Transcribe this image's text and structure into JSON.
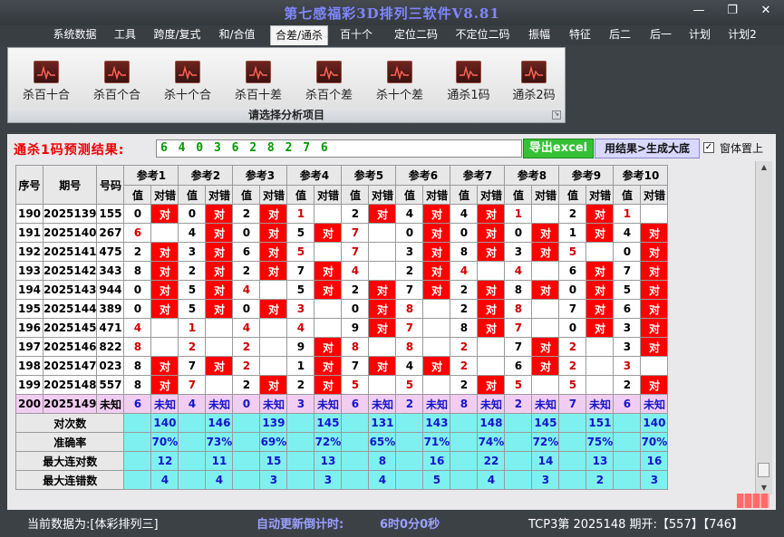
{
  "window": {
    "title": "第七感福彩3D排列三软件V8.81"
  },
  "menu": [
    "系统数据",
    "工具",
    "跨度/复式",
    "和/合值",
    "合差/通杀",
    "百十个",
    "定位二码",
    "不定位二码",
    "振幅",
    "特征",
    "后二",
    "后一",
    "计划",
    "计划2"
  ],
  "menu_active": "合差/通杀",
  "ribbon": {
    "buttons": [
      "杀百十合",
      "杀百个合",
      "杀十个合",
      "杀百十差",
      "杀百个差",
      "杀十个差",
      "通杀1码",
      "通杀2码"
    ],
    "footer": "请选择分析项目",
    "icon": "chart-icon"
  },
  "prediction": {
    "label": "通杀1码预测结果:",
    "value": "6 4 0 3 6 2 8 2 7 6"
  },
  "buttons": {
    "excel": "导出excel",
    "generate": "用结果>生成大底",
    "ontop": "窗体置上",
    "ontop_checked": "✓"
  },
  "table": {
    "headers": {
      "seq": "序号",
      "issue": "期号",
      "number": "号码",
      "refs": [
        "参考1",
        "参考2",
        "参考3",
        "参考4",
        "参考5",
        "参考6",
        "参考7",
        "参考8",
        "参考9",
        "参考10"
      ],
      "val": "值",
      "cmp": "对错"
    },
    "rows": [
      {
        "seq": "190",
        "issue": "2025139",
        "number": "155",
        "cells": [
          [
            "0",
            "对"
          ],
          [
            "0",
            "对"
          ],
          [
            "2",
            "对"
          ],
          [
            "1",
            ""
          ],
          [
            "2",
            "对"
          ],
          [
            "4",
            "对"
          ],
          [
            "4",
            "对"
          ],
          [
            "1",
            ""
          ],
          [
            "2",
            "对"
          ],
          [
            "1",
            ""
          ]
        ]
      },
      {
        "seq": "191",
        "issue": "2025140",
        "number": "267",
        "cells": [
          [
            "6",
            ""
          ],
          [
            "4",
            "对"
          ],
          [
            "0",
            "对"
          ],
          [
            "5",
            "对"
          ],
          [
            "7",
            ""
          ],
          [
            "0",
            "对"
          ],
          [
            "0",
            "对"
          ],
          [
            "0",
            "对"
          ],
          [
            "1",
            "对"
          ],
          [
            "4",
            "对"
          ]
        ]
      },
      {
        "seq": "192",
        "issue": "2025141",
        "number": "475",
        "cells": [
          [
            "2",
            "对"
          ],
          [
            "3",
            "对"
          ],
          [
            "6",
            "对"
          ],
          [
            "5",
            ""
          ],
          [
            "7",
            ""
          ],
          [
            "3",
            "对"
          ],
          [
            "8",
            "对"
          ],
          [
            "3",
            "对"
          ],
          [
            "5",
            ""
          ],
          [
            "0",
            "对"
          ]
        ]
      },
      {
        "seq": "193",
        "issue": "2025142",
        "number": "343",
        "cells": [
          [
            "8",
            "对"
          ],
          [
            "2",
            "对"
          ],
          [
            "2",
            "对"
          ],
          [
            "7",
            "对"
          ],
          [
            "4",
            ""
          ],
          [
            "2",
            "对"
          ],
          [
            "4",
            ""
          ],
          [
            "4",
            ""
          ],
          [
            "6",
            "对"
          ],
          [
            "7",
            "对"
          ]
        ]
      },
      {
        "seq": "194",
        "issue": "2025143",
        "number": "944",
        "cells": [
          [
            "0",
            "对"
          ],
          [
            "5",
            "对"
          ],
          [
            "4",
            ""
          ],
          [
            "5",
            "对"
          ],
          [
            "2",
            "对"
          ],
          [
            "7",
            "对"
          ],
          [
            "2",
            "对"
          ],
          [
            "8",
            "对"
          ],
          [
            "0",
            "对"
          ],
          [
            "5",
            "对"
          ]
        ]
      },
      {
        "seq": "195",
        "issue": "2025144",
        "number": "389",
        "cells": [
          [
            "0",
            "对"
          ],
          [
            "5",
            "对"
          ],
          [
            "0",
            "对"
          ],
          [
            "3",
            ""
          ],
          [
            "0",
            "对"
          ],
          [
            "8",
            ""
          ],
          [
            "2",
            "对"
          ],
          [
            "8",
            ""
          ],
          [
            "7",
            "对"
          ],
          [
            "6",
            "对"
          ]
        ]
      },
      {
        "seq": "196",
        "issue": "2025145",
        "number": "471",
        "cells": [
          [
            "4",
            ""
          ],
          [
            "1",
            ""
          ],
          [
            "4",
            ""
          ],
          [
            "4",
            ""
          ],
          [
            "9",
            "对"
          ],
          [
            "7",
            ""
          ],
          [
            "8",
            "对"
          ],
          [
            "7",
            ""
          ],
          [
            "0",
            "对"
          ],
          [
            "3",
            "对"
          ]
        ]
      },
      {
        "seq": "197",
        "issue": "2025146",
        "number": "822",
        "cells": [
          [
            "8",
            ""
          ],
          [
            "2",
            ""
          ],
          [
            "2",
            ""
          ],
          [
            "9",
            "对"
          ],
          [
            "8",
            ""
          ],
          [
            "8",
            ""
          ],
          [
            "2",
            ""
          ],
          [
            "7",
            "对"
          ],
          [
            "2",
            ""
          ],
          [
            "3",
            "对"
          ]
        ]
      },
      {
        "seq": "198",
        "issue": "2025147",
        "number": "023",
        "cells": [
          [
            "8",
            "对"
          ],
          [
            "7",
            "对"
          ],
          [
            "2",
            ""
          ],
          [
            "1",
            "对"
          ],
          [
            "7",
            "对"
          ],
          [
            "4",
            "对"
          ],
          [
            "2",
            ""
          ],
          [
            "6",
            "对"
          ],
          [
            "2",
            ""
          ],
          [
            "3",
            ""
          ]
        ]
      },
      {
        "seq": "199",
        "issue": "2025148",
        "number": "557",
        "cells": [
          [
            "8",
            "对"
          ],
          [
            "7",
            ""
          ],
          [
            "2",
            "对"
          ],
          [
            "2",
            "对"
          ],
          [
            "5",
            ""
          ],
          [
            "5",
            ""
          ],
          [
            "2",
            "对"
          ],
          [
            "5",
            ""
          ],
          [
            "5",
            ""
          ],
          [
            "2",
            "对"
          ]
        ]
      }
    ],
    "unknown_row": {
      "seq": "200",
      "issue": "2025149",
      "number": "未知",
      "values": [
        "6",
        "4",
        "0",
        "3",
        "6",
        "2",
        "8",
        "2",
        "7",
        "6"
      ],
      "text": "未知"
    },
    "stats": [
      {
        "label": "对次数",
        "values": [
          "140",
          "146",
          "139",
          "145",
          "131",
          "143",
          "148",
          "145",
          "151",
          "140"
        ]
      },
      {
        "label": "准确率",
        "values": [
          "70%",
          "73%",
          "69%",
          "72%",
          "65%",
          "71%",
          "74%",
          "72%",
          "75%",
          "70%"
        ]
      },
      {
        "label": "最大连对数",
        "values": [
          "12",
          "11",
          "15",
          "13",
          "8",
          "16",
          "22",
          "14",
          "13",
          "16"
        ]
      },
      {
        "label": "最大连错数",
        "values": [
          "4",
          "4",
          "3",
          "3",
          "4",
          "5",
          "4",
          "3",
          "2",
          "3"
        ]
      }
    ]
  },
  "status": {
    "current": "当前数据为:[体彩排列三]",
    "countdown_label": "自动更新倒计时:",
    "countdown": "6时0分0秒",
    "draw": "TCP3第 2025148 期开:【557】【746】"
  },
  "colors": {
    "hit": "#ff0000",
    "stat_bg": "#7ff0f0",
    "unknown_bg": "#f2cdf2",
    "title": "#7f86ff",
    "excel": "#35c135"
  }
}
